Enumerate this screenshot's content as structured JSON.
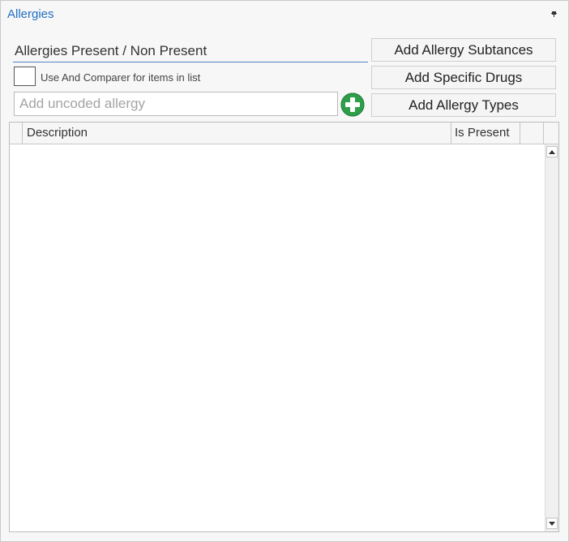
{
  "panel": {
    "title": "Allergies",
    "pin_icon": "pin-icon"
  },
  "section": {
    "label": "Allergies Present / Non Present"
  },
  "checkbox": {
    "checked": false,
    "label": "Use And Comparer for items in list"
  },
  "uncoded_input": {
    "placeholder": "Add uncoded allergy",
    "value": "",
    "add_icon": "plus-circle-icon",
    "add_icon_color": "#2e9e4a"
  },
  "buttons": {
    "substances": "Add Allergy Subtances",
    "drugs": "Add Specific Drugs",
    "types": "Add Allergy Types"
  },
  "grid": {
    "columns": [
      "Description",
      "Is Present"
    ],
    "rows": []
  },
  "colors": {
    "title": "#1f6fc0",
    "underline": "#5a82c8",
    "add_icon": "#2e9e4a"
  }
}
